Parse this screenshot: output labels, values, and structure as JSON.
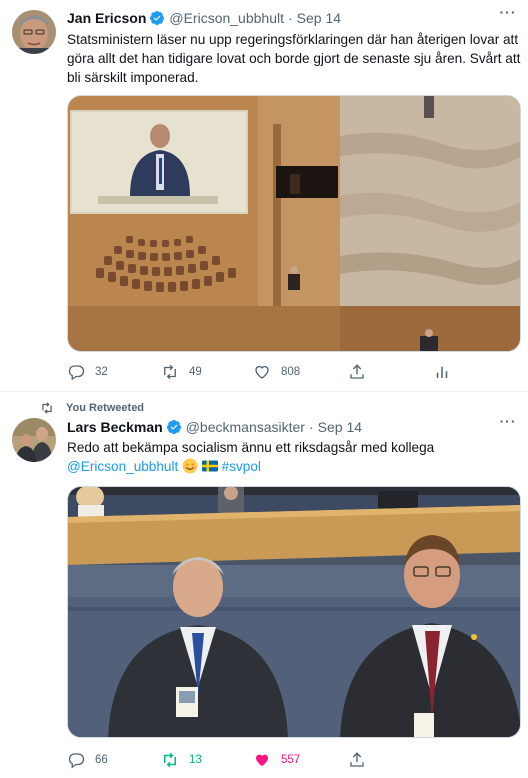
{
  "tweets": [
    {
      "name": "Jan Ericson",
      "handle": "@Ericson_ubbhult",
      "separator": "·",
      "date": "Sep 14",
      "text": "Statsministern läser nu upp regeringsförklaringen där han återigen lovar att göra allt det han tidigare lovat och borde gjort de senaste sju åren. Svårt att bli särskilt imponerad.",
      "replies": "32",
      "retweets": "49",
      "likes": "808"
    },
    {
      "retweet_context": "You Retweeted",
      "name": "Lars Beckman",
      "handle": "@beckmansasikter",
      "separator": "·",
      "date": "Sep 14",
      "text_main": "Redo att bekämpa socialism ännu ett riksdagsår med kollega",
      "mention": "@Ericson_ubbhult",
      "hashtag": "#svpol",
      "replies": "66",
      "retweets": "13",
      "likes": "557"
    }
  ],
  "colors": {
    "accent": "#1d9bf0",
    "retweet_active": "#00ba7c",
    "like_active": "#f91880",
    "secondary_text": "#536471"
  }
}
